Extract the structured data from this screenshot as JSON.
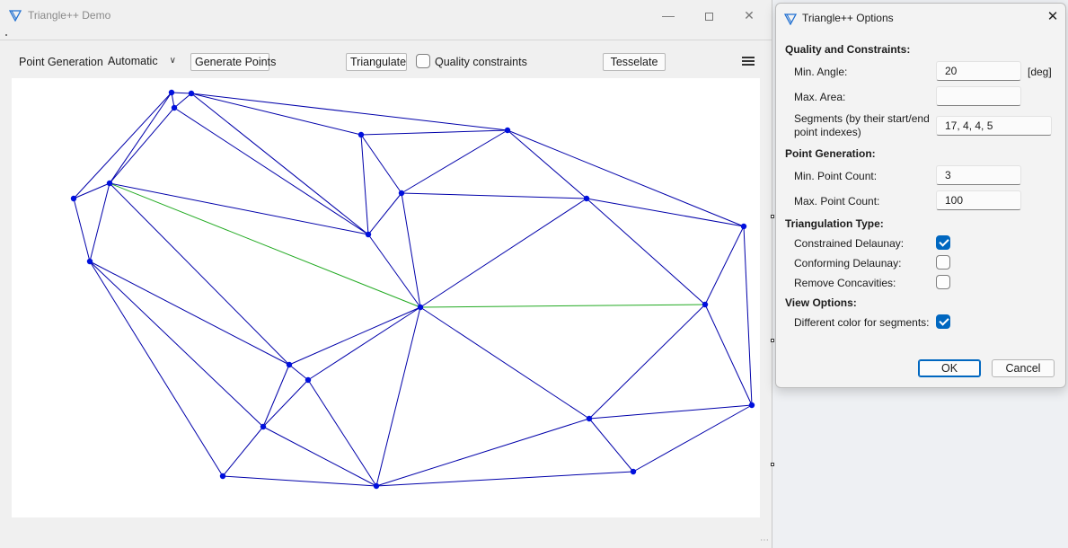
{
  "main": {
    "title": "Triangle++ Demo",
    "toolbar": {
      "point_generation_label": "Point Generation",
      "point_generation_value": "Automatic",
      "generate_label": "Generate Points",
      "triangulate_label": "Triangulate",
      "quality_label": "Quality constraints",
      "quality_checked": false,
      "tesselate_label": "Tesselate"
    }
  },
  "dialog": {
    "title": "Triangle++ Options",
    "sections": {
      "quality": "Quality and Constraints:",
      "point_gen": "Point Generation:",
      "tri_type": "Triangulation Type:",
      "view": "View Options:"
    },
    "min_angle": {
      "label": "Min. Angle:",
      "value": "20",
      "unit": "[deg]"
    },
    "max_area": {
      "label": "Max. Area:",
      "value": ""
    },
    "segments": {
      "label_line1": "Segments (by their start/end",
      "label_line2": "point indexes)",
      "value": "17, 4, 4, 5"
    },
    "min_points": {
      "label": "Min. Point Count:",
      "value": "3"
    },
    "max_points": {
      "label": "Max. Point Count:",
      "value": "100"
    },
    "constrained": {
      "label": "Constrained Delaunay:",
      "checked": true
    },
    "conforming": {
      "label": "Conforming Delaunay:",
      "checked": false
    },
    "concavities": {
      "label": "Remove Concavities:",
      "checked": false
    },
    "diff_color": {
      "label": "Different color for segments:",
      "checked": true
    },
    "ok_label": "OK",
    "cancel_label": "Cancel"
  },
  "colors": {
    "edge": "#0000aa",
    "segment": "#22aa22",
    "vertex": "#0010dd",
    "accent": "#0067c0"
  },
  "mesh": {
    "points": [
      [
        191,
        103
      ],
      [
        213,
        104
      ],
      [
        194,
        120
      ],
      [
        122,
        204
      ],
      [
        82,
        221
      ],
      [
        100,
        291
      ],
      [
        402,
        150
      ],
      [
        565,
        145
      ],
      [
        447,
        215
      ],
      [
        410,
        261
      ],
      [
        653,
        221
      ],
      [
        828,
        252
      ],
      [
        468,
        342
      ],
      [
        785,
        339
      ],
      [
        837,
        451
      ],
      [
        322,
        406
      ],
      [
        343,
        423
      ],
      [
        293,
        475
      ],
      [
        656,
        466
      ],
      [
        705,
        525
      ],
      [
        248,
        530
      ],
      [
        419,
        541
      ]
    ],
    "edges": [
      [
        0,
        1
      ],
      [
        0,
        2
      ],
      [
        1,
        2
      ],
      [
        0,
        3
      ],
      [
        0,
        4
      ],
      [
        2,
        3
      ],
      [
        4,
        3
      ],
      [
        4,
        5
      ],
      [
        3,
        5
      ],
      [
        1,
        6
      ],
      [
        6,
        7
      ],
      [
        1,
        7
      ],
      [
        1,
        9
      ],
      [
        2,
        9
      ],
      [
        6,
        9
      ],
      [
        6,
        8
      ],
      [
        8,
        9
      ],
      [
        3,
        9
      ],
      [
        8,
        7
      ],
      [
        7,
        11
      ],
      [
        7,
        10
      ],
      [
        8,
        10
      ],
      [
        10,
        11
      ],
      [
        10,
        12
      ],
      [
        10,
        13
      ],
      [
        11,
        13
      ],
      [
        11,
        14
      ],
      [
        13,
        14
      ],
      [
        8,
        12
      ],
      [
        9,
        12
      ],
      [
        3,
        15
      ],
      [
        5,
        15
      ],
      [
        5,
        17
      ],
      [
        5,
        20
      ],
      [
        12,
        15
      ],
      [
        12,
        16
      ],
      [
        12,
        21
      ],
      [
        12,
        18
      ],
      [
        13,
        18
      ],
      [
        18,
        14
      ],
      [
        14,
        19
      ],
      [
        18,
        19
      ],
      [
        15,
        16
      ],
      [
        15,
        17
      ],
      [
        16,
        17
      ],
      [
        16,
        21
      ],
      [
        17,
        20
      ],
      [
        17,
        21
      ],
      [
        20,
        21
      ],
      [
        21,
        18
      ],
      [
        21,
        19
      ]
    ],
    "segments": [
      [
        3,
        12
      ],
      [
        12,
        13
      ]
    ]
  }
}
